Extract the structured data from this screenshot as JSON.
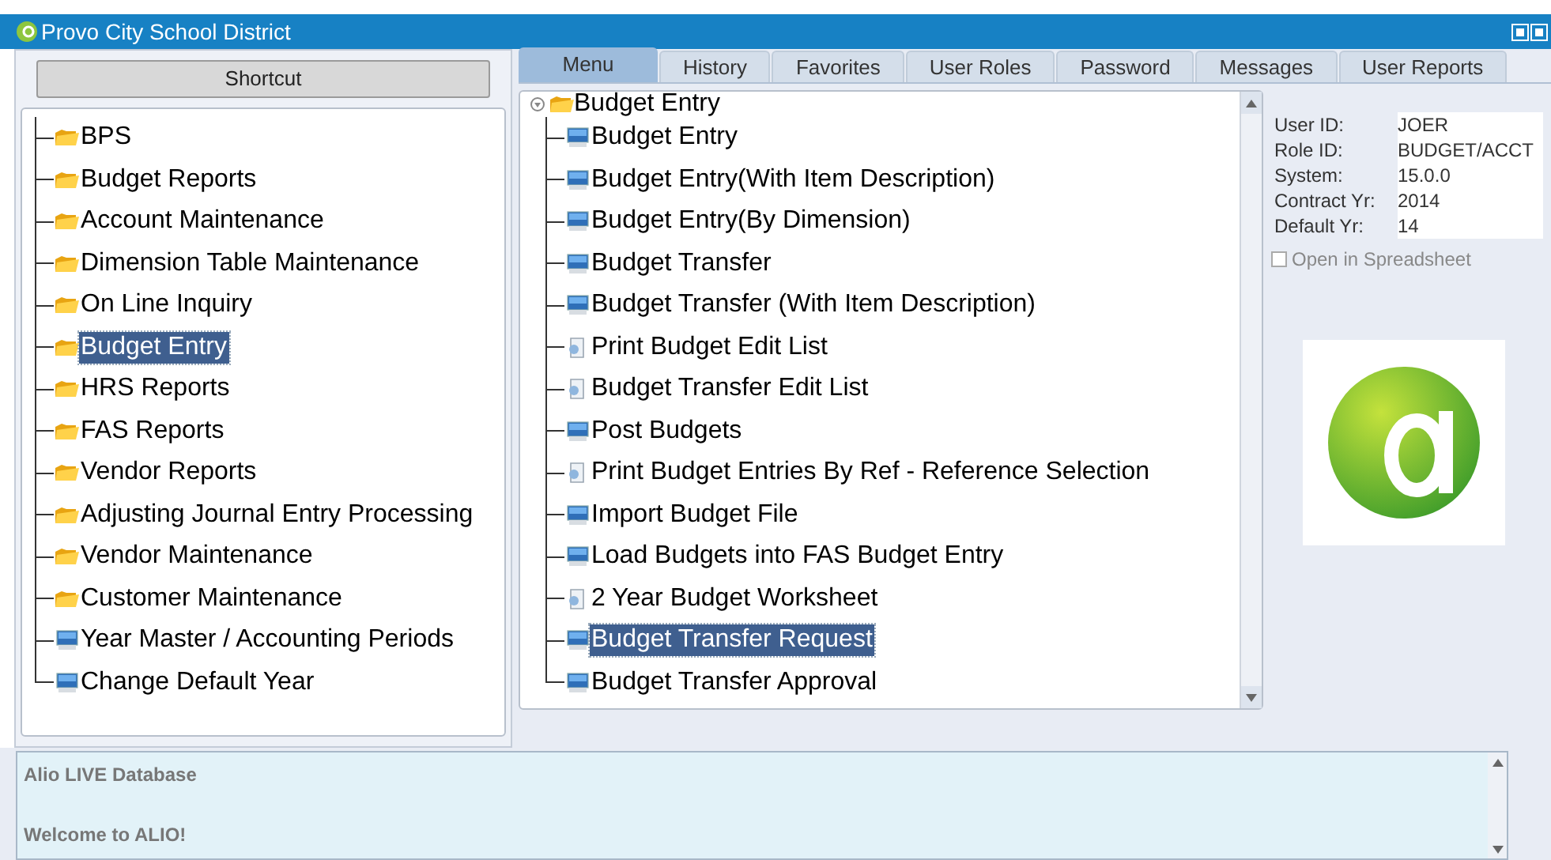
{
  "window": {
    "title": "Provo City School District"
  },
  "shortcut_button": "Shortcut",
  "sidebar": {
    "items": [
      {
        "label": "BPS",
        "kind": "folder",
        "selected": false
      },
      {
        "label": "Budget Reports",
        "kind": "folder",
        "selected": false
      },
      {
        "label": "Account Maintenance",
        "kind": "folder",
        "selected": false
      },
      {
        "label": "Dimension Table Maintenance",
        "kind": "folder",
        "selected": false
      },
      {
        "label": "On Line Inquiry",
        "kind": "folder",
        "selected": false
      },
      {
        "label": "Budget Entry",
        "kind": "folder",
        "selected": true
      },
      {
        "label": "HRS Reports",
        "kind": "folder",
        "selected": false
      },
      {
        "label": "FAS Reports",
        "kind": "folder",
        "selected": false
      },
      {
        "label": "Vendor Reports",
        "kind": "folder",
        "selected": false
      },
      {
        "label": "Adjusting Journal Entry Processing",
        "kind": "folder",
        "selected": false
      },
      {
        "label": "Vendor Maintenance",
        "kind": "folder",
        "selected": false
      },
      {
        "label": "Customer Maintenance",
        "kind": "folder",
        "selected": false
      },
      {
        "label": "Year Master / Accounting Periods",
        "kind": "program",
        "selected": false
      },
      {
        "label": "Change Default Year",
        "kind": "program",
        "selected": false
      }
    ]
  },
  "tabs": [
    {
      "label": "Menu",
      "selected": true
    },
    {
      "label": "History",
      "selected": false
    },
    {
      "label": "Favorites",
      "selected": false
    },
    {
      "label": "User Roles",
      "selected": false
    },
    {
      "label": "Password",
      "selected": false
    },
    {
      "label": "Messages",
      "selected": false
    },
    {
      "label": "User Reports",
      "selected": false
    }
  ],
  "menu_tree": {
    "label": "Budget Entry",
    "expanded": true,
    "children": [
      {
        "label": "Budget Entry",
        "kind": "program",
        "selected": false
      },
      {
        "label": "Budget Entry(With Item Description)",
        "kind": "program",
        "selected": false
      },
      {
        "label": "Budget Entry(By Dimension)",
        "kind": "program",
        "selected": false
      },
      {
        "label": "Budget Transfer",
        "kind": "program",
        "selected": false
      },
      {
        "label": "Budget Transfer (With Item Description)",
        "kind": "program",
        "selected": false
      },
      {
        "label": "Print Budget Edit List",
        "kind": "report",
        "selected": false
      },
      {
        "label": "Budget Transfer Edit List",
        "kind": "report",
        "selected": false
      },
      {
        "label": "Post Budgets",
        "kind": "program",
        "selected": false
      },
      {
        "label": "Print Budget Entries By Ref - Reference Selection",
        "kind": "report",
        "selected": false
      },
      {
        "label": "Import Budget File",
        "kind": "program",
        "selected": false
      },
      {
        "label": "Load Budgets into FAS Budget Entry",
        "kind": "program",
        "selected": false
      },
      {
        "label": "2 Year Budget Worksheet",
        "kind": "report",
        "selected": false
      },
      {
        "label": "Budget Transfer Request",
        "kind": "program",
        "selected": true
      },
      {
        "label": "Budget Transfer Approval",
        "kind": "program",
        "selected": false
      }
    ]
  },
  "info": [
    {
      "label": "User ID:",
      "value": "JOER"
    },
    {
      "label": "Role ID:",
      "value": "BUDGET/ACCT"
    },
    {
      "label": "System:",
      "value": "15.0.0"
    },
    {
      "label": "Contract Yr:",
      "value": "2014"
    },
    {
      "label": "Default Yr:",
      "value": "14"
    }
  ],
  "open_in_spreadsheet": {
    "label": "Open in Spreadsheet",
    "checked": false
  },
  "messages": [
    "Alio LIVE Database",
    "Welcome to ALIO!"
  ]
}
